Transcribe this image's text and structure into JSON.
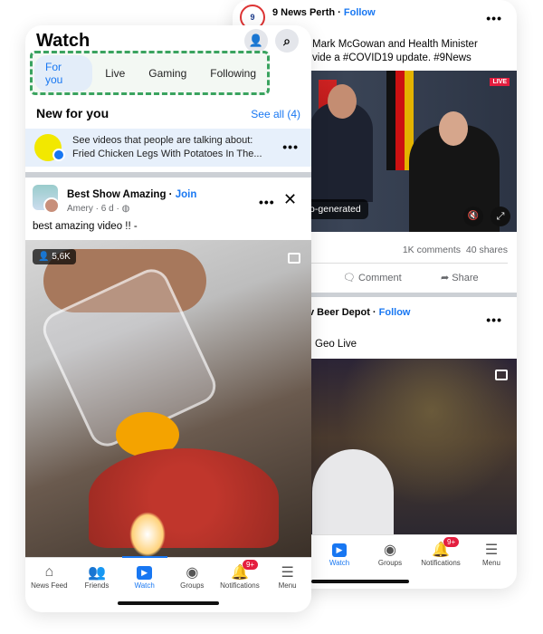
{
  "back": {
    "page_name": "9 News Perth",
    "follow": "Follow",
    "caption_line1": "Mark McGowan and Health Minister",
    "caption_line2": "vide a #COVID19 update. #9News",
    "live": "LIVE",
    "captions_notice": "Captions are auto-generated",
    "comments": "1K comments",
    "shares": "40 shares",
    "comment_label": "Comment",
    "share_label": "Share",
    "post2_name": "v Beer Depot",
    "post2_follow": "Follow",
    "post2_caption": "Geo Live",
    "nav": [
      {
        "label": "Watch"
      },
      {
        "label": "Groups"
      },
      {
        "label": "Notifications",
        "badge": "9+"
      },
      {
        "label": "Menu"
      }
    ]
  },
  "front": {
    "title": "Watch",
    "tabs": [
      {
        "label": "For you"
      },
      {
        "label": "Live"
      },
      {
        "label": "Gaming"
      },
      {
        "label": "Following"
      }
    ],
    "new_for_you": "New for you",
    "see_all": "See all (4)",
    "suggest_line1": "See videos that people are talking about:",
    "suggest_line2": "Fried Chicken Legs With Potatoes In The...",
    "post_name": "Best Show Amazing",
    "join": "Join",
    "post_meta": "Amery · 6 d ·",
    "post_text": "best amazing video !! -",
    "viewers": "5,6K",
    "nav": [
      {
        "label": "News Feed"
      },
      {
        "label": "Friends"
      },
      {
        "label": "Watch"
      },
      {
        "label": "Groups"
      },
      {
        "label": "Notifications",
        "badge": "9+"
      },
      {
        "label": "Menu"
      }
    ]
  },
  "colors": {
    "accent": "#1877f2",
    "highlight_border": "#3aa35f",
    "badge": "#e41e3f"
  }
}
